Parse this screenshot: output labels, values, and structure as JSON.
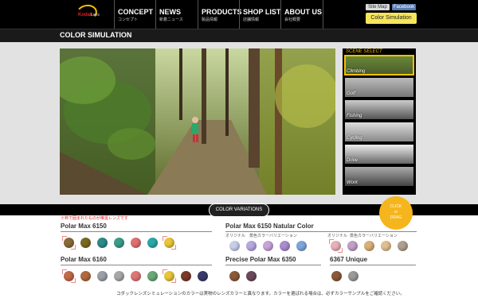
{
  "brand": {
    "name": "Kodak",
    "suffix": "Lens"
  },
  "nav": [
    {
      "en": "CONCEPT",
      "jp": "コンセプト"
    },
    {
      "en": "NEWS",
      "jp": "新着ニュース"
    },
    {
      "en": "PRODUCTS",
      "jp": "製品情報"
    },
    {
      "en": "SHOP LIST",
      "jp": "店舗情報"
    },
    {
      "en": "ABOUT US",
      "jp": "会社概要"
    }
  ],
  "links": {
    "sitemap": "Site Map",
    "facebook": "Facebook",
    "color_sim": "Color Simulation"
  },
  "page_title": "COLOR SIMULATION",
  "scene_select": {
    "header": "SCENE SELECT",
    "scenes": [
      "Climbing",
      "Golf",
      "Fishing",
      "Cycling",
      "Drive",
      "Work"
    ],
    "selected": "Climbing"
  },
  "color_variations_label": "COLOR VARIATIONS",
  "drag_badge": {
    "line1": "CLICK",
    "line2": "or",
    "line3": "DRAG"
  },
  "note": "※枠で囲まれたものが推奨レンズです",
  "sections": {
    "pm6150": {
      "title": "Polar Max 6150",
      "colors": [
        "#8a6b3a",
        "#7a6a1e",
        "#2e8a8a",
        "#3a9d8a",
        "#e07070",
        "#2aa8a8",
        "#e8c53a"
      ]
    },
    "pm6160": {
      "title": "Polar Max 6160",
      "colors": [
        "#c06a4a",
        "#b06a3e",
        "#9aa0a5",
        "#a8a8a8",
        "#e07676",
        "#6aa878",
        "#e8c53a",
        "#7a3a2a",
        "#3a3a6a"
      ]
    },
    "pm6150n": {
      "title": "Polar Max 6150 Natular Color",
      "sub_orig": "オリジナル",
      "sub_var": "蒸色カラーバリエーション",
      "colors": [
        "#c7cfe8",
        "#b7a8e0",
        "#c8a4d8",
        "#a98dd0",
        "#7ea6dc"
      ]
    },
    "ppm6350": {
      "title": "Precise Polar Max 6350",
      "colors": [
        "#8a5a3a",
        "#6a4a5a"
      ]
    },
    "u6367": {
      "title": "6367 Unique",
      "sub_orig": "オリジナル",
      "sub_var": "蒸色カラーバリエーション",
      "colors": [
        "#e8b0b8",
        "#c0a0c8",
        "#d8b078",
        "#e0c090",
        "#b0a090"
      ],
      "colors2": [
        "#8a5a3a",
        "#9a9a9a"
      ]
    }
  },
  "footnote": "コダックレンズシミュレーションのカラーは実物のレンズカラーと異なります。カラーを選ばれる場合は、必ずカラーサンプルをご確認ください。"
}
